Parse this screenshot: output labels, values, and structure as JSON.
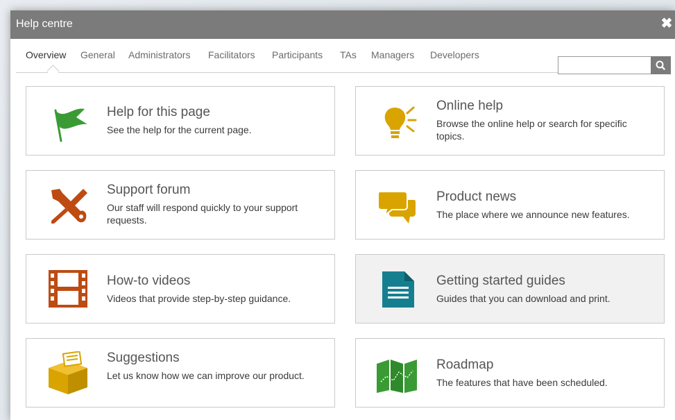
{
  "dialog": {
    "title": "Help centre",
    "close_icon": "close-icon"
  },
  "tabs": [
    {
      "label": "Overview",
      "active": true
    },
    {
      "label": "General"
    },
    {
      "label": "Administrators"
    },
    {
      "label": "Facilitators"
    },
    {
      "label": "Participants"
    },
    {
      "label": "TAs"
    },
    {
      "label": "Managers"
    },
    {
      "label": "Developers"
    }
  ],
  "search": {
    "value": "",
    "placeholder": "",
    "icon": "search-icon"
  },
  "cards": [
    {
      "title": "Help for this page",
      "description": "See the help for the current page.",
      "icon": "flag-icon",
      "icon_color": "#3a9b35"
    },
    {
      "title": "Online help",
      "description": "Browse the online help or search for specific topics.",
      "icon": "lightbulb-icon",
      "icon_color": "#d9a400"
    },
    {
      "title": "Support forum",
      "description": "Our staff will respond quickly to your support requests.",
      "icon": "tools-icon",
      "icon_color": "#bd4b12"
    },
    {
      "title": "Product news",
      "description": "The place where we announce new features.",
      "icon": "chat-bubbles-icon",
      "icon_color": "#d9a400"
    },
    {
      "title": "How-to videos",
      "description": "Videos that provide step-by-step guidance.",
      "icon": "film-icon",
      "icon_color": "#bd4b12"
    },
    {
      "title": "Getting started guides",
      "description": "Guides that you can download and print.",
      "icon": "document-icon",
      "icon_color": "#167f8f"
    },
    {
      "title": "Suggestions",
      "description": "Let us know how we can improve our product.",
      "icon": "suggestion-box-icon",
      "icon_color": "#d9a400"
    },
    {
      "title": "Roadmap",
      "description": "The features that have been scheduled.",
      "icon": "map-icon",
      "icon_color": "#3a9b35"
    }
  ]
}
